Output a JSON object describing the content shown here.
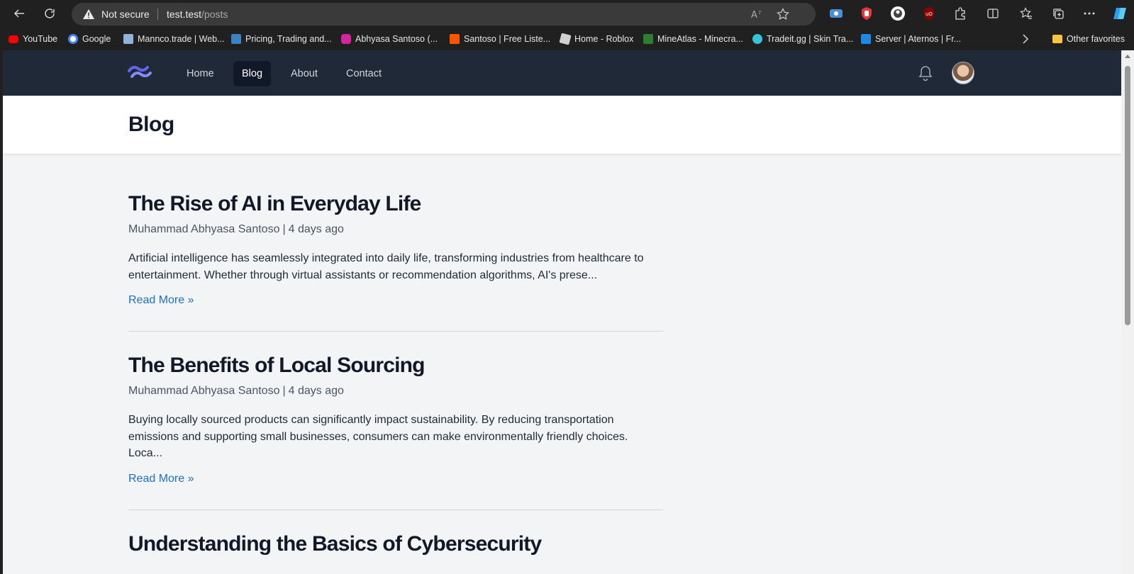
{
  "browser": {
    "security_label": "Not secure",
    "url_host": "test.test",
    "url_path": "/posts"
  },
  "bookmarks": [
    {
      "label": "YouTube",
      "color": "#ff0000"
    },
    {
      "label": "Google",
      "color": "#4285f4"
    },
    {
      "label": "Mannco.trade | Web...",
      "color": "#8fb3d9"
    },
    {
      "label": "Pricing, Trading and...",
      "color": "#3b82c4"
    },
    {
      "label": "Abhyasa Santoso (...",
      "color": "#d6249f"
    },
    {
      "label": "Santoso | Free Liste...",
      "color": "#ff5500"
    },
    {
      "label": "Home - Roblox",
      "color": "#d0d0d0"
    },
    {
      "label": "MineAtlas - Minecra...",
      "color": "#2e7d32"
    },
    {
      "label": "Tradeit.gg | Skin Tra...",
      "color": "#36c5d6"
    },
    {
      "label": "Server | Aternos | Fr...",
      "color": "#1e88e5"
    }
  ],
  "other_favorites": "Other favorites",
  "site": {
    "nav": [
      {
        "label": "Home",
        "active": false
      },
      {
        "label": "Blog",
        "active": true
      },
      {
        "label": "About",
        "active": false
      },
      {
        "label": "Contact",
        "active": false
      }
    ],
    "page_title": "Blog",
    "posts": [
      {
        "title": "The Rise of AI in Everyday Life",
        "author": "Muhammad Abhyasa Santoso",
        "date": "4 days ago",
        "excerpt": "Artificial intelligence has seamlessly integrated into daily life, transforming industries from healthcare to entertainment. Whether through virtual assistants or recommendation algorithms, AI's prese...",
        "read_more": "Read More »"
      },
      {
        "title": "The Benefits of Local Sourcing",
        "author": "Muhammad Abhyasa Santoso",
        "date": "4 days ago",
        "excerpt": "Buying locally sourced products can significantly impact sustainability. By reducing transportation emissions and supporting small businesses, consumers can make environmentally friendly choices. Loca...",
        "read_more": "Read More »"
      },
      {
        "title": "Understanding the Basics of Cybersecurity"
      }
    ]
  }
}
